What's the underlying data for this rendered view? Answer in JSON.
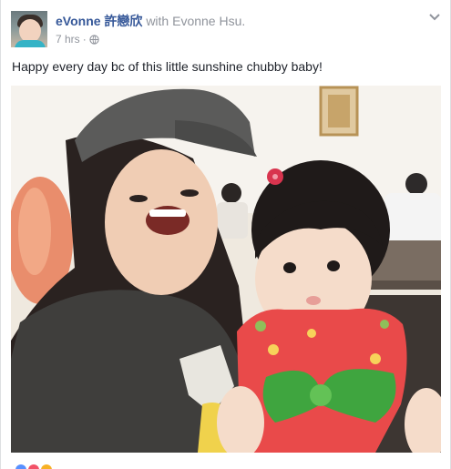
{
  "post": {
    "author": "eVonne 許戀欣",
    "with_text": "with",
    "tagged": "Evonne Hsu.",
    "time": "7 hrs",
    "separator": "·",
    "privacy_icon": "globe-icon",
    "menu_icon": "chevron-down-icon",
    "caption": "Happy every day bc of this little sunshine chubby baby!"
  }
}
